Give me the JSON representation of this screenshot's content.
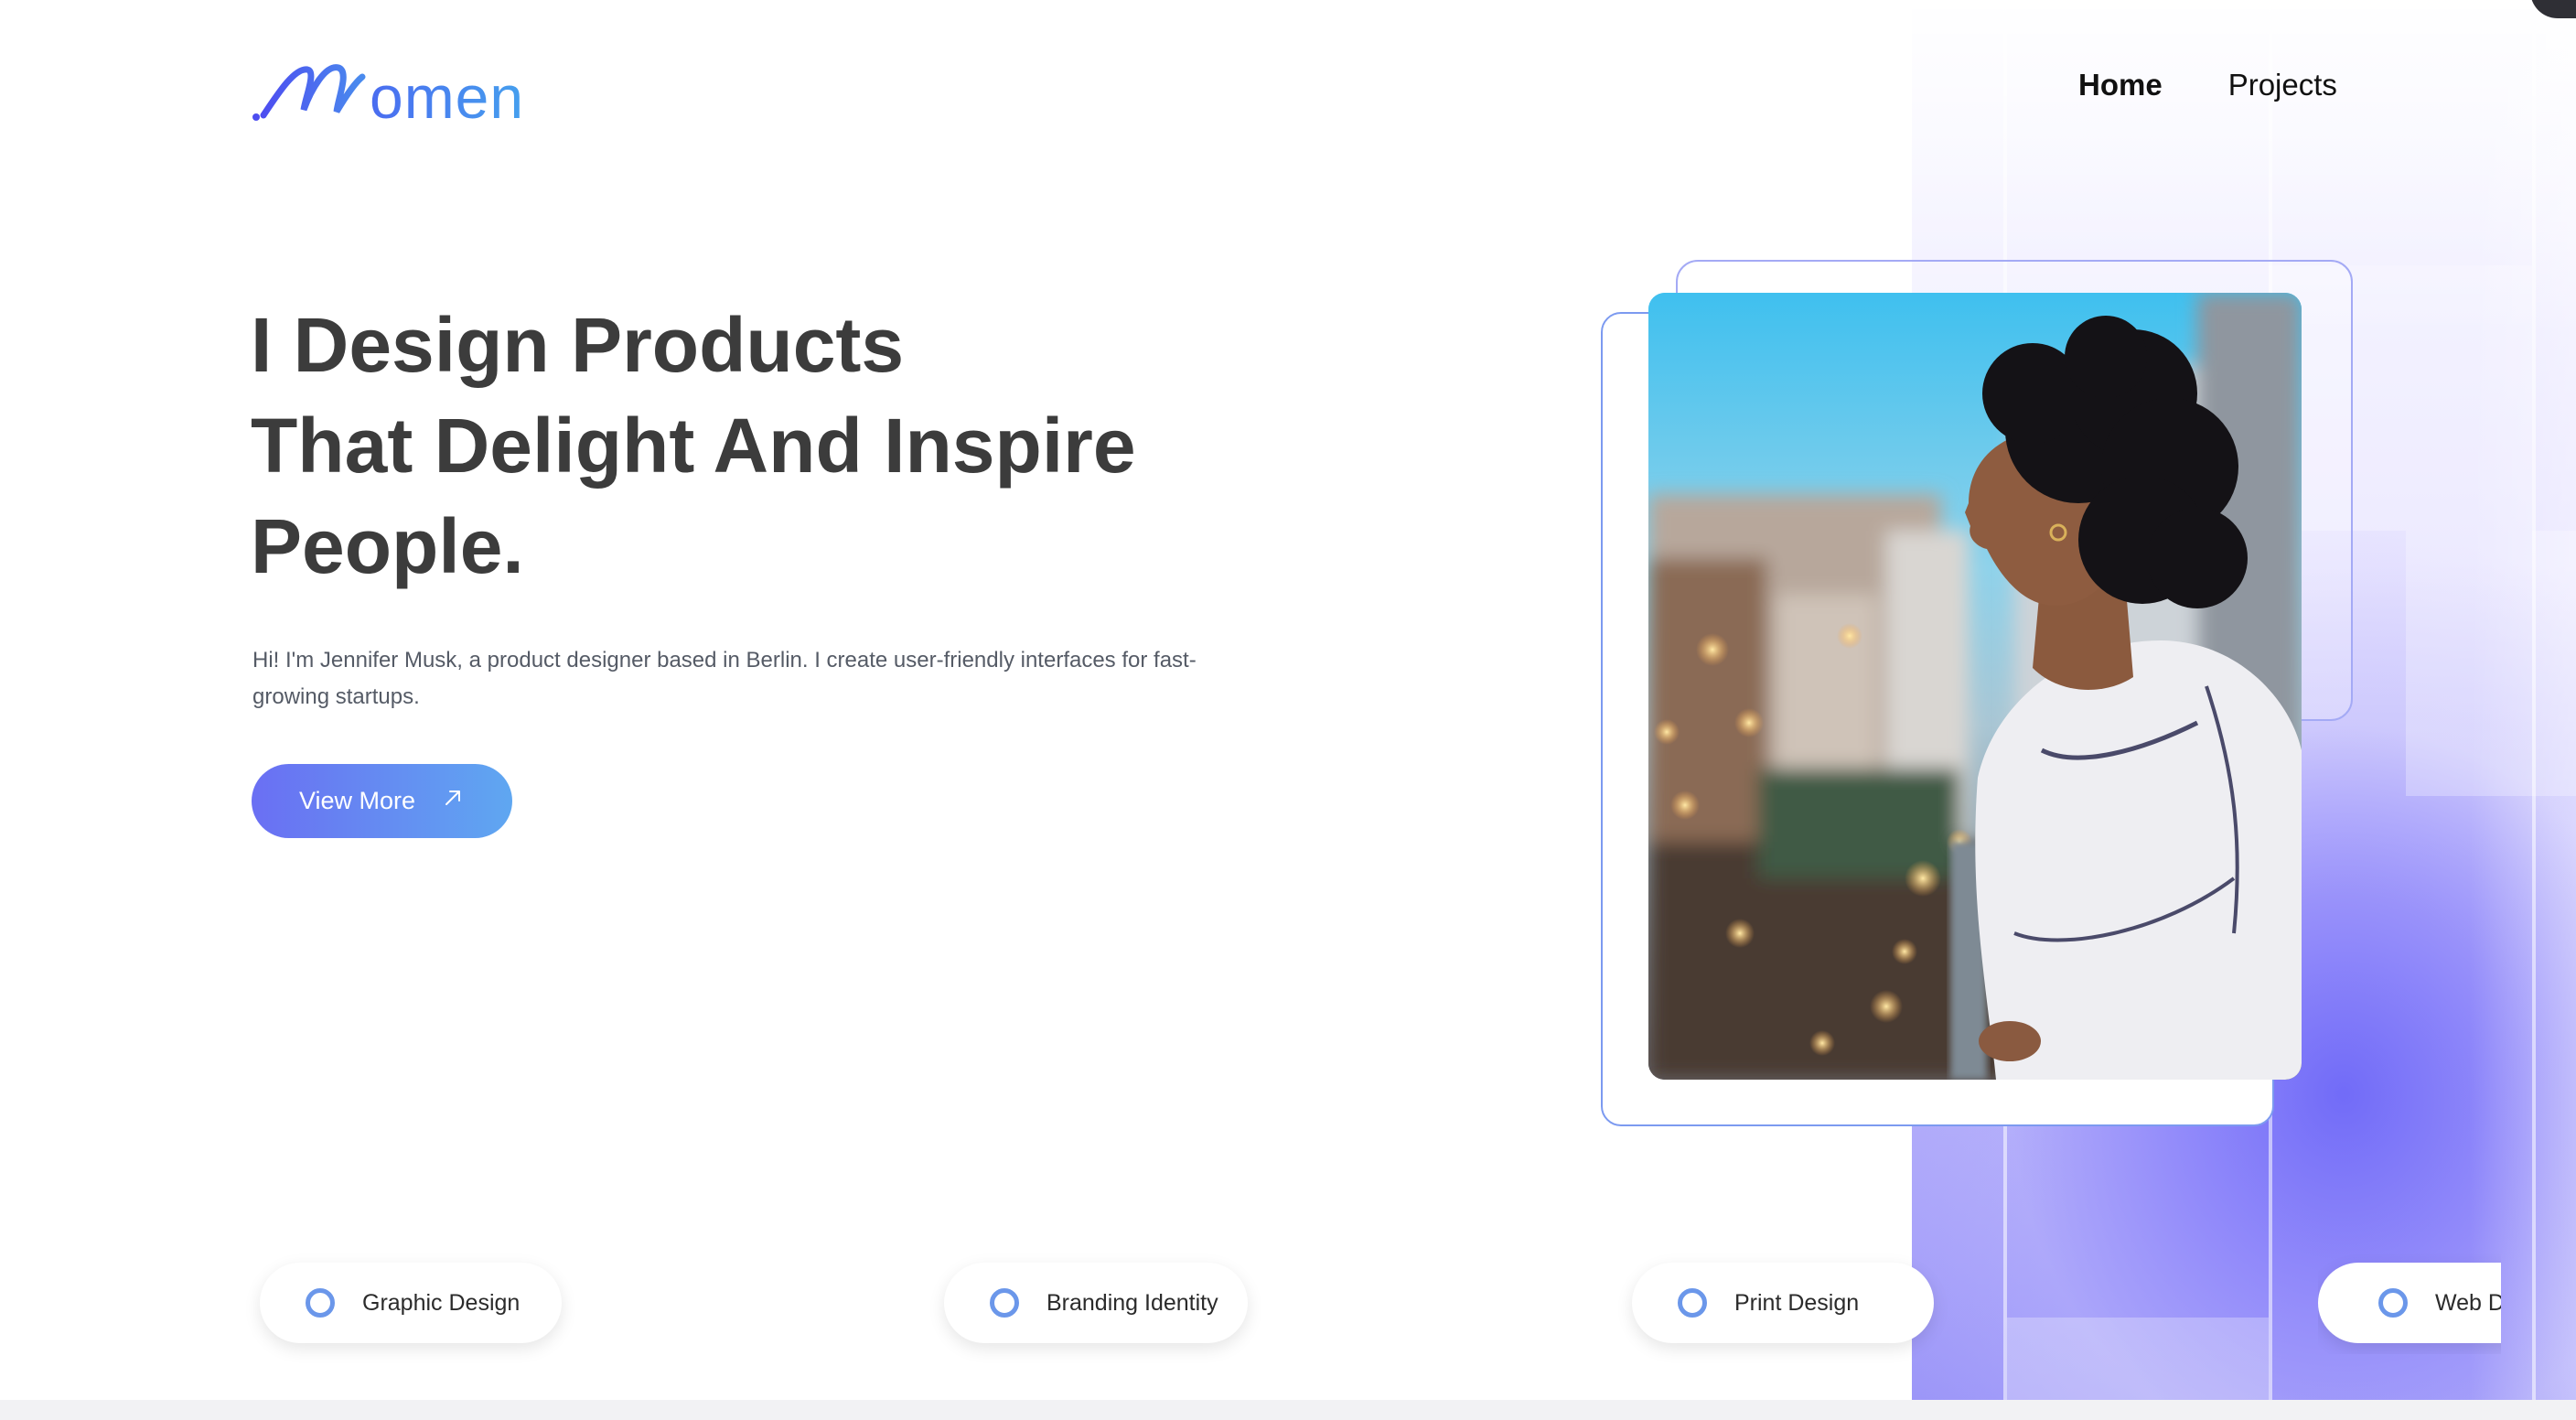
{
  "brand": {
    "logo_text": "omen",
    "primary_color": "#3f86e8",
    "accent_gradient": [
      "#6a6ff3",
      "#5fa7f1"
    ]
  },
  "nav": {
    "items": [
      {
        "label": "Home",
        "active": true
      },
      {
        "label": "Projects",
        "active": false
      }
    ]
  },
  "hero": {
    "title_lines": [
      "I Design Products",
      "That Delight And Inspire",
      "People."
    ],
    "description": "Hi! I'm Jennifer Musk, a product designer based in Berlin. I create user-friendly interfaces for fast-growing startups.",
    "cta_label": "View More",
    "cta_icon": "arrow-up-right-icon",
    "image_alt": "Woman with curly hair leaning over a balcony overlooking a city at dusk"
  },
  "services": [
    {
      "label": "Graphic Design",
      "icon": "ring-icon"
    },
    {
      "label": "Branding Identity",
      "icon": "ring-icon"
    },
    {
      "label": "Print Design",
      "icon": "ring-icon"
    },
    {
      "label": "Web Design",
      "icon": "ring-icon"
    }
  ],
  "colors": {
    "heading": "#3c3c3c",
    "ring": "#6b97ea",
    "background_glow": "#6e68f8"
  }
}
